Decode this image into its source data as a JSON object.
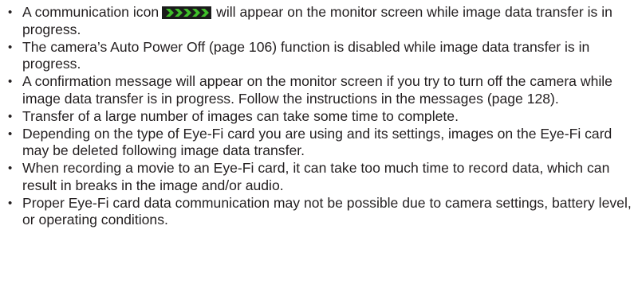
{
  "bullet_char": "•",
  "notes": [
    {
      "before_icon": "A communication icon",
      "after_icon": "will appear on the monitor screen while image data transfer is in progress.",
      "icon": "communication-arrows-icon",
      "icon_colors": {
        "background": "#1b1b1b",
        "arrow": "#3fbf2a"
      }
    },
    {
      "text": "The camera’s Auto Power Off (page 106) function is disabled while image data transfer is in progress."
    },
    {
      "text": "A confirmation message will appear on the monitor screen if you try to turn off the camera while image data transfer is in progress. Follow the instructions in the messages (page 128)."
    },
    {
      "text": "Transfer of a large number of images can take some time to complete."
    },
    {
      "text": "Depending on the type of Eye-Fi card you are using and its settings, images on the Eye-Fi card may be deleted following image data transfer."
    },
    {
      "text": "When recording a movie to an Eye-Fi card, it can take too much time to record data, which can result in breaks in the image and/or audio."
    },
    {
      "text": "Proper Eye-Fi card data communication may not be possible due to camera settings, battery level, or operating conditions."
    }
  ]
}
